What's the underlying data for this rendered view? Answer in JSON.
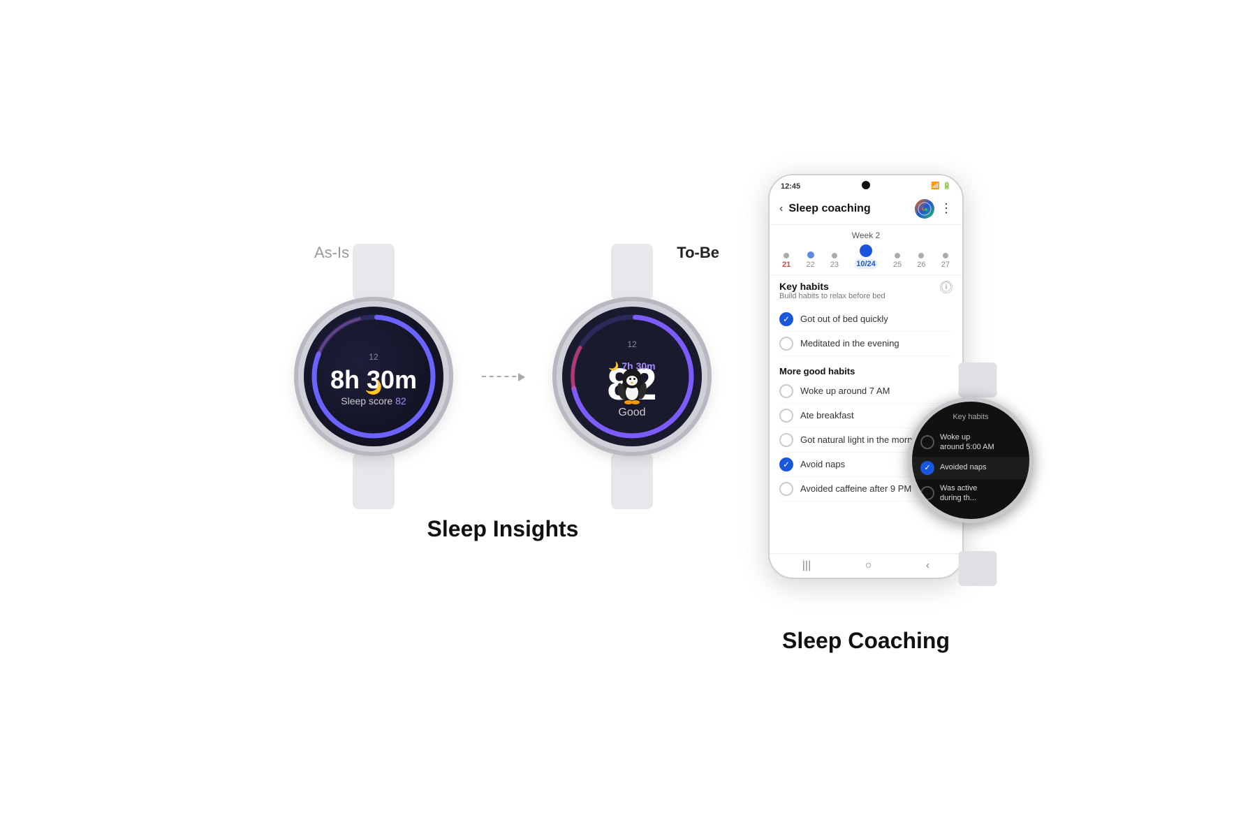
{
  "page": {
    "background": "#ffffff"
  },
  "sleep_insights": {
    "label_as_is": "As-Is",
    "label_to_be": "To-Be",
    "section_title": "Sleep Insights",
    "watch_asis": {
      "twelve": "12",
      "time": "8h 30m",
      "score_label": "Sleep score 82",
      "score_value": "82"
    },
    "watch_tobe": {
      "twelve": "12",
      "time_badge": "7h 30m",
      "score": "82",
      "good": "Good"
    }
  },
  "sleep_coaching": {
    "section_title": "Sleep Coaching",
    "phone": {
      "status_time": "12:45",
      "app_title": "Sleep coaching",
      "week_label": "Week 2",
      "days": [
        {
          "num": "21",
          "type": "red",
          "dot": "small"
        },
        {
          "num": "22",
          "type": "normal",
          "dot": "filled"
        },
        {
          "num": "23",
          "type": "normal",
          "dot": "small"
        },
        {
          "num": "10/24",
          "type": "selected",
          "dot": "active"
        },
        {
          "num": "25",
          "type": "normal",
          "dot": "small"
        },
        {
          "num": "26",
          "type": "normal",
          "dot": "small"
        },
        {
          "num": "27",
          "type": "normal",
          "dot": "small"
        }
      ],
      "key_habits": {
        "title": "Key habits",
        "subtitle": "Build habits to relax before bed",
        "items": [
          {
            "text": "Got out of bed quickly",
            "checked": true
          },
          {
            "text": "Meditated in the evening",
            "checked": false
          }
        ]
      },
      "more_habits": {
        "title": "More good habits",
        "items": [
          {
            "text": "Woke up around 7 AM",
            "checked": false
          },
          {
            "text": "Ate breakfast",
            "checked": false
          },
          {
            "text": "Got natural light in the morning",
            "checked": false
          },
          {
            "text": "Avoid naps",
            "checked": true
          },
          {
            "text": "Avoided caffeine after 9 PM",
            "checked": false
          }
        ]
      }
    },
    "smartwatch": {
      "title": "Key habits",
      "items": [
        {
          "text": "Woke up\naround 5:00 AM",
          "checked": false
        },
        {
          "text": "Avoided naps",
          "checked": true
        },
        {
          "text": "Was active\nduring th...",
          "checked": false
        }
      ]
    }
  }
}
